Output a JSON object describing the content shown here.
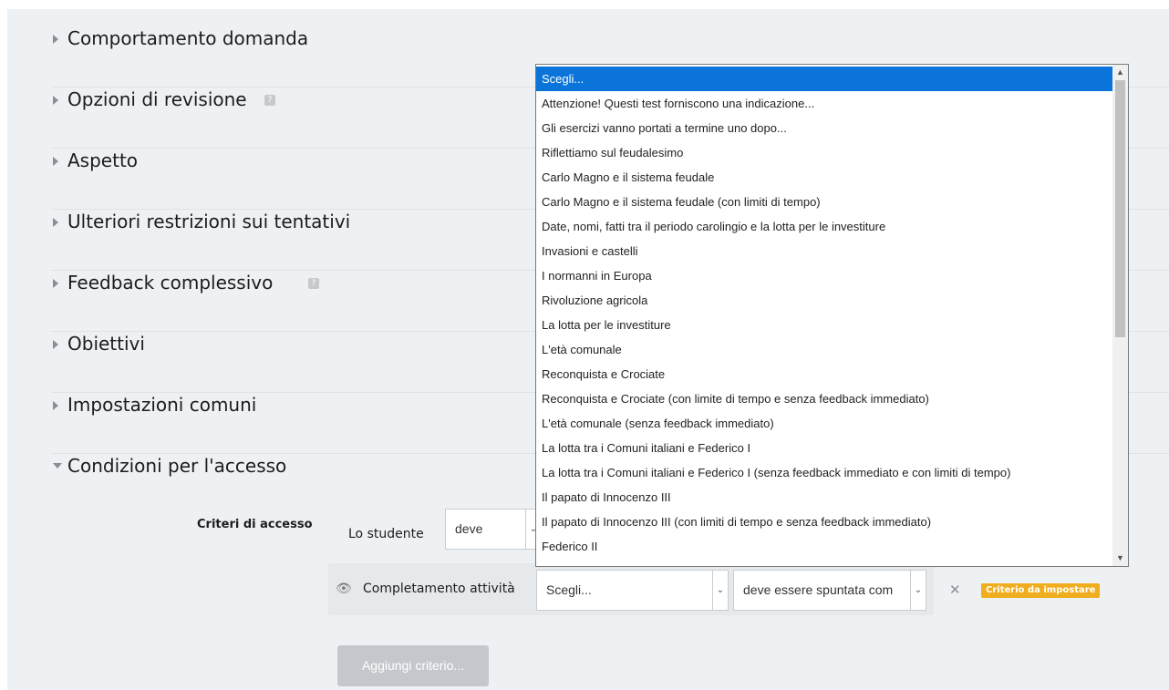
{
  "sections": [
    {
      "title": "Comportamento domanda",
      "expanded": false,
      "help": false
    },
    {
      "title": "Opzioni di revisione",
      "expanded": false,
      "help": true
    },
    {
      "title": "Aspetto",
      "expanded": false,
      "help": false
    },
    {
      "title": "Ulteriori restrizioni sui tentativi",
      "expanded": false,
      "help": false
    },
    {
      "title": "Feedback complessivo",
      "expanded": false,
      "help": true
    },
    {
      "title": "Obiettivi",
      "expanded": false,
      "help": false
    },
    {
      "title": "Impostazioni comuni",
      "expanded": false,
      "help": false
    },
    {
      "title": "Condizioni per l'accesso",
      "expanded": true,
      "help": false
    }
  ],
  "help_glyph": "?",
  "access": {
    "criteria_label": "Criteri di accesso",
    "student_label": "Lo studente",
    "must_select": "deve",
    "condition_label": "Completamento attività",
    "activity_select": "Scegli...",
    "completion_select": "deve essere spuntata com",
    "remove_glyph": "✕",
    "badge": "Criterio da impostare",
    "add_button": "Aggiungi criterio..."
  },
  "dropdown": {
    "selected_index": 0,
    "options": [
      "Scegli...",
      "Attenzione! Questi test forniscono una indicazione...",
      "Gli esercizi vanno portati a termine uno dopo...",
      "Riflettiamo sul feudalesimo",
      "Carlo Magno e il sistema feudale",
      "Carlo Magno e il sistema feudale (con limiti di tempo)",
      "Date, nomi, fatti tra il periodo carolingio e la lotta per le investiture",
      "Invasioni e castelli",
      "I normanni in Europa",
      "Rivoluzione agricola",
      "La lotta per le investiture",
      "L'età comunale",
      "Reconquista e Crociate",
      "Reconquista e Crociate (con limite di tempo e senza feedback immediato)",
      "L'età comunale (senza feedback immediato)",
      "La lotta tra i Comuni italiani e Federico I",
      "La lotta tra i Comuni italiani e Federico I (senza feedback immediato e con limiti di tempo)",
      "Il papato di Innocenzo III",
      "Il papato di Innocenzo III (con limiti di tempo e senza feedback immediato)",
      "Federico II"
    ]
  },
  "colors": {
    "accent": "#0a74da",
    "badge": "#f0ad1e",
    "background": "#eef1f3"
  }
}
